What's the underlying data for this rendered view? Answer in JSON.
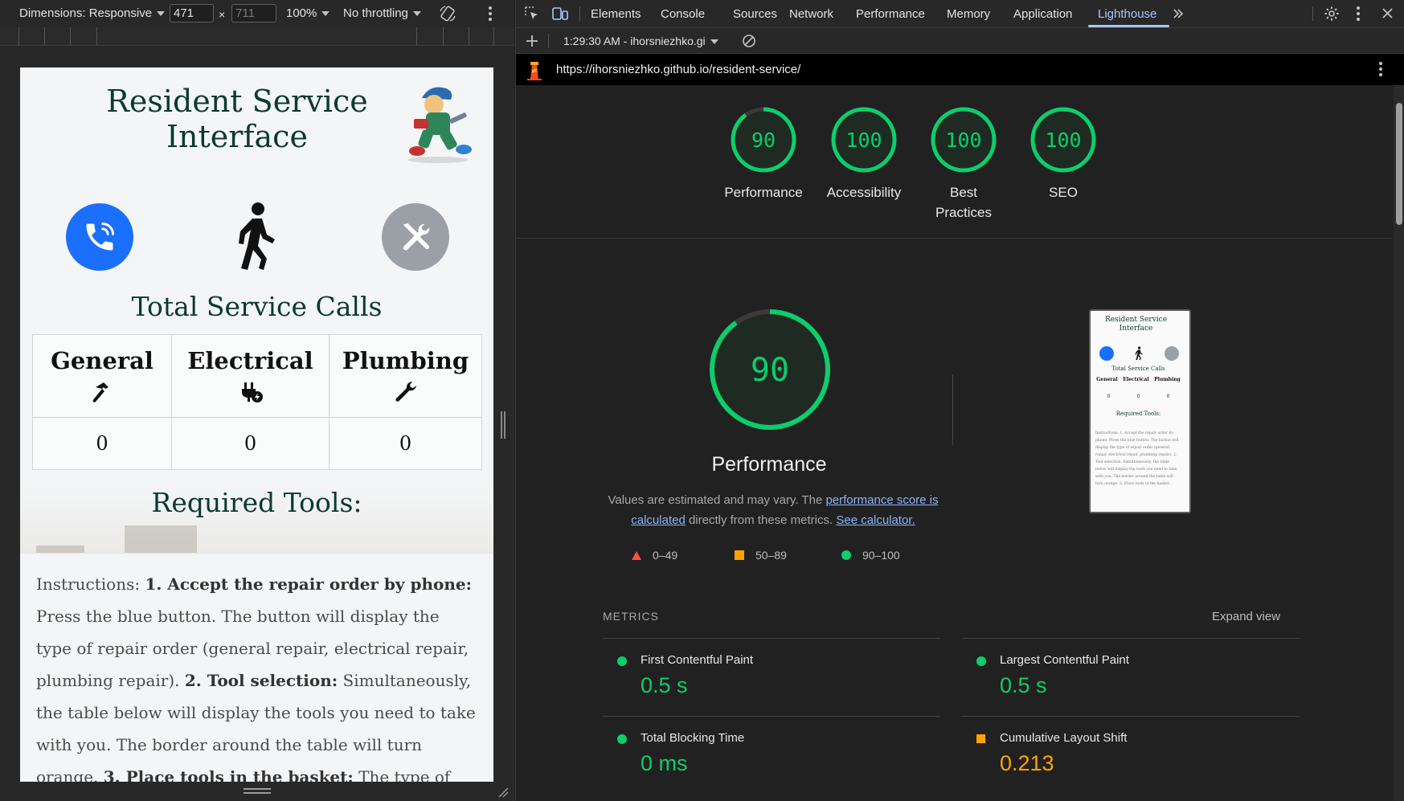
{
  "device_toolbar": {
    "dimensions_label": "Dimensions: Responsive",
    "width": "471",
    "height_placeholder": "711",
    "times": "×",
    "zoom": "100%",
    "throttling": "No throttling"
  },
  "site": {
    "title_line1": "Resident Service",
    "title_line2": "Interface",
    "calls_title": "Total Service Calls",
    "columns": [
      {
        "name": "General",
        "icon": "hammer-icon",
        "count": "0"
      },
      {
        "name": "Electrical",
        "icon": "plug-icon",
        "count": "0"
      },
      {
        "name": "Plumbing",
        "icon": "wrench-icon",
        "count": "0"
      }
    ],
    "tools_title": "Required Tools:",
    "instructions": {
      "lead": "Instructions: ",
      "step1_bold": "1. Accept the repair order by phone:",
      "step1_text": " Press the blue button. The button will display the type of repair order (general repair, electrical repair, plumbing repair). ",
      "step2_bold": "2. Tool selection:",
      "step2_text": " Simultaneously, the table below will display the tools you need to take with you. The border around the table will turn orange. ",
      "step3_bold": "3. Place tools in the basket:",
      "step3_text": " The type of the"
    }
  },
  "devtools": {
    "tabs": [
      "Elements",
      "Console",
      "Sources",
      "Network",
      "Performance",
      "Memory",
      "Application",
      "Lighthouse"
    ],
    "active_tab": "Lighthouse",
    "report_selector": "1:29:30 AM - ihorsniezhko.gi",
    "url": "https://ihorsniezhko.github.io/resident-service/"
  },
  "lighthouse": {
    "categories": [
      {
        "label": "Performance",
        "score": 90
      },
      {
        "label": "Accessibility",
        "score": 100
      },
      {
        "label": "Best Practices",
        "score": 100
      },
      {
        "label": "SEO",
        "score": 100
      }
    ],
    "main_score": 90,
    "main_title": "Performance",
    "desc_part1": "Values are estimated and may vary. The ",
    "desc_link1": "performance score is calculated",
    "desc_part2": " directly from these metrics. ",
    "desc_link2": "See calculator.",
    "legend": [
      "0–49",
      "50–89",
      "90–100"
    ],
    "metrics_label": "METRICS",
    "expand_view": "Expand view",
    "metrics": [
      {
        "name": "First Contentful Paint",
        "value": "0.5 s",
        "status": "good"
      },
      {
        "name": "Largest Contentful Paint",
        "value": "0.5 s",
        "status": "good"
      },
      {
        "name": "Total Blocking Time",
        "value": "0 ms",
        "status": "good"
      },
      {
        "name": "Cumulative Layout Shift",
        "value": "0.213",
        "status": "average"
      }
    ],
    "thumbnail": {
      "title1": "Resident Service",
      "title2": "Interface",
      "calls": "Total Service Calls",
      "cols": [
        "General",
        "Electrical",
        "Plumbing"
      ],
      "counts": [
        "0",
        "0",
        "0"
      ],
      "tools": "Required Tools:",
      "text": "Instructions: 1. Accept the repair order by phone: Press the blue button. The button will display the type of repair order (general repair, electrical repair, plumbing repair). 2. Tool selection: Simultaneously, the table below will display the tools you need to take with you. The border around the table will turn orange. 3. Place tools in the basket:"
    }
  },
  "colors": {
    "pass": "#0cce6b",
    "average": "#ffa400",
    "fail": "#ff4e42",
    "accent": "#a8c7fa",
    "phone_button": "#1a6ffd"
  }
}
